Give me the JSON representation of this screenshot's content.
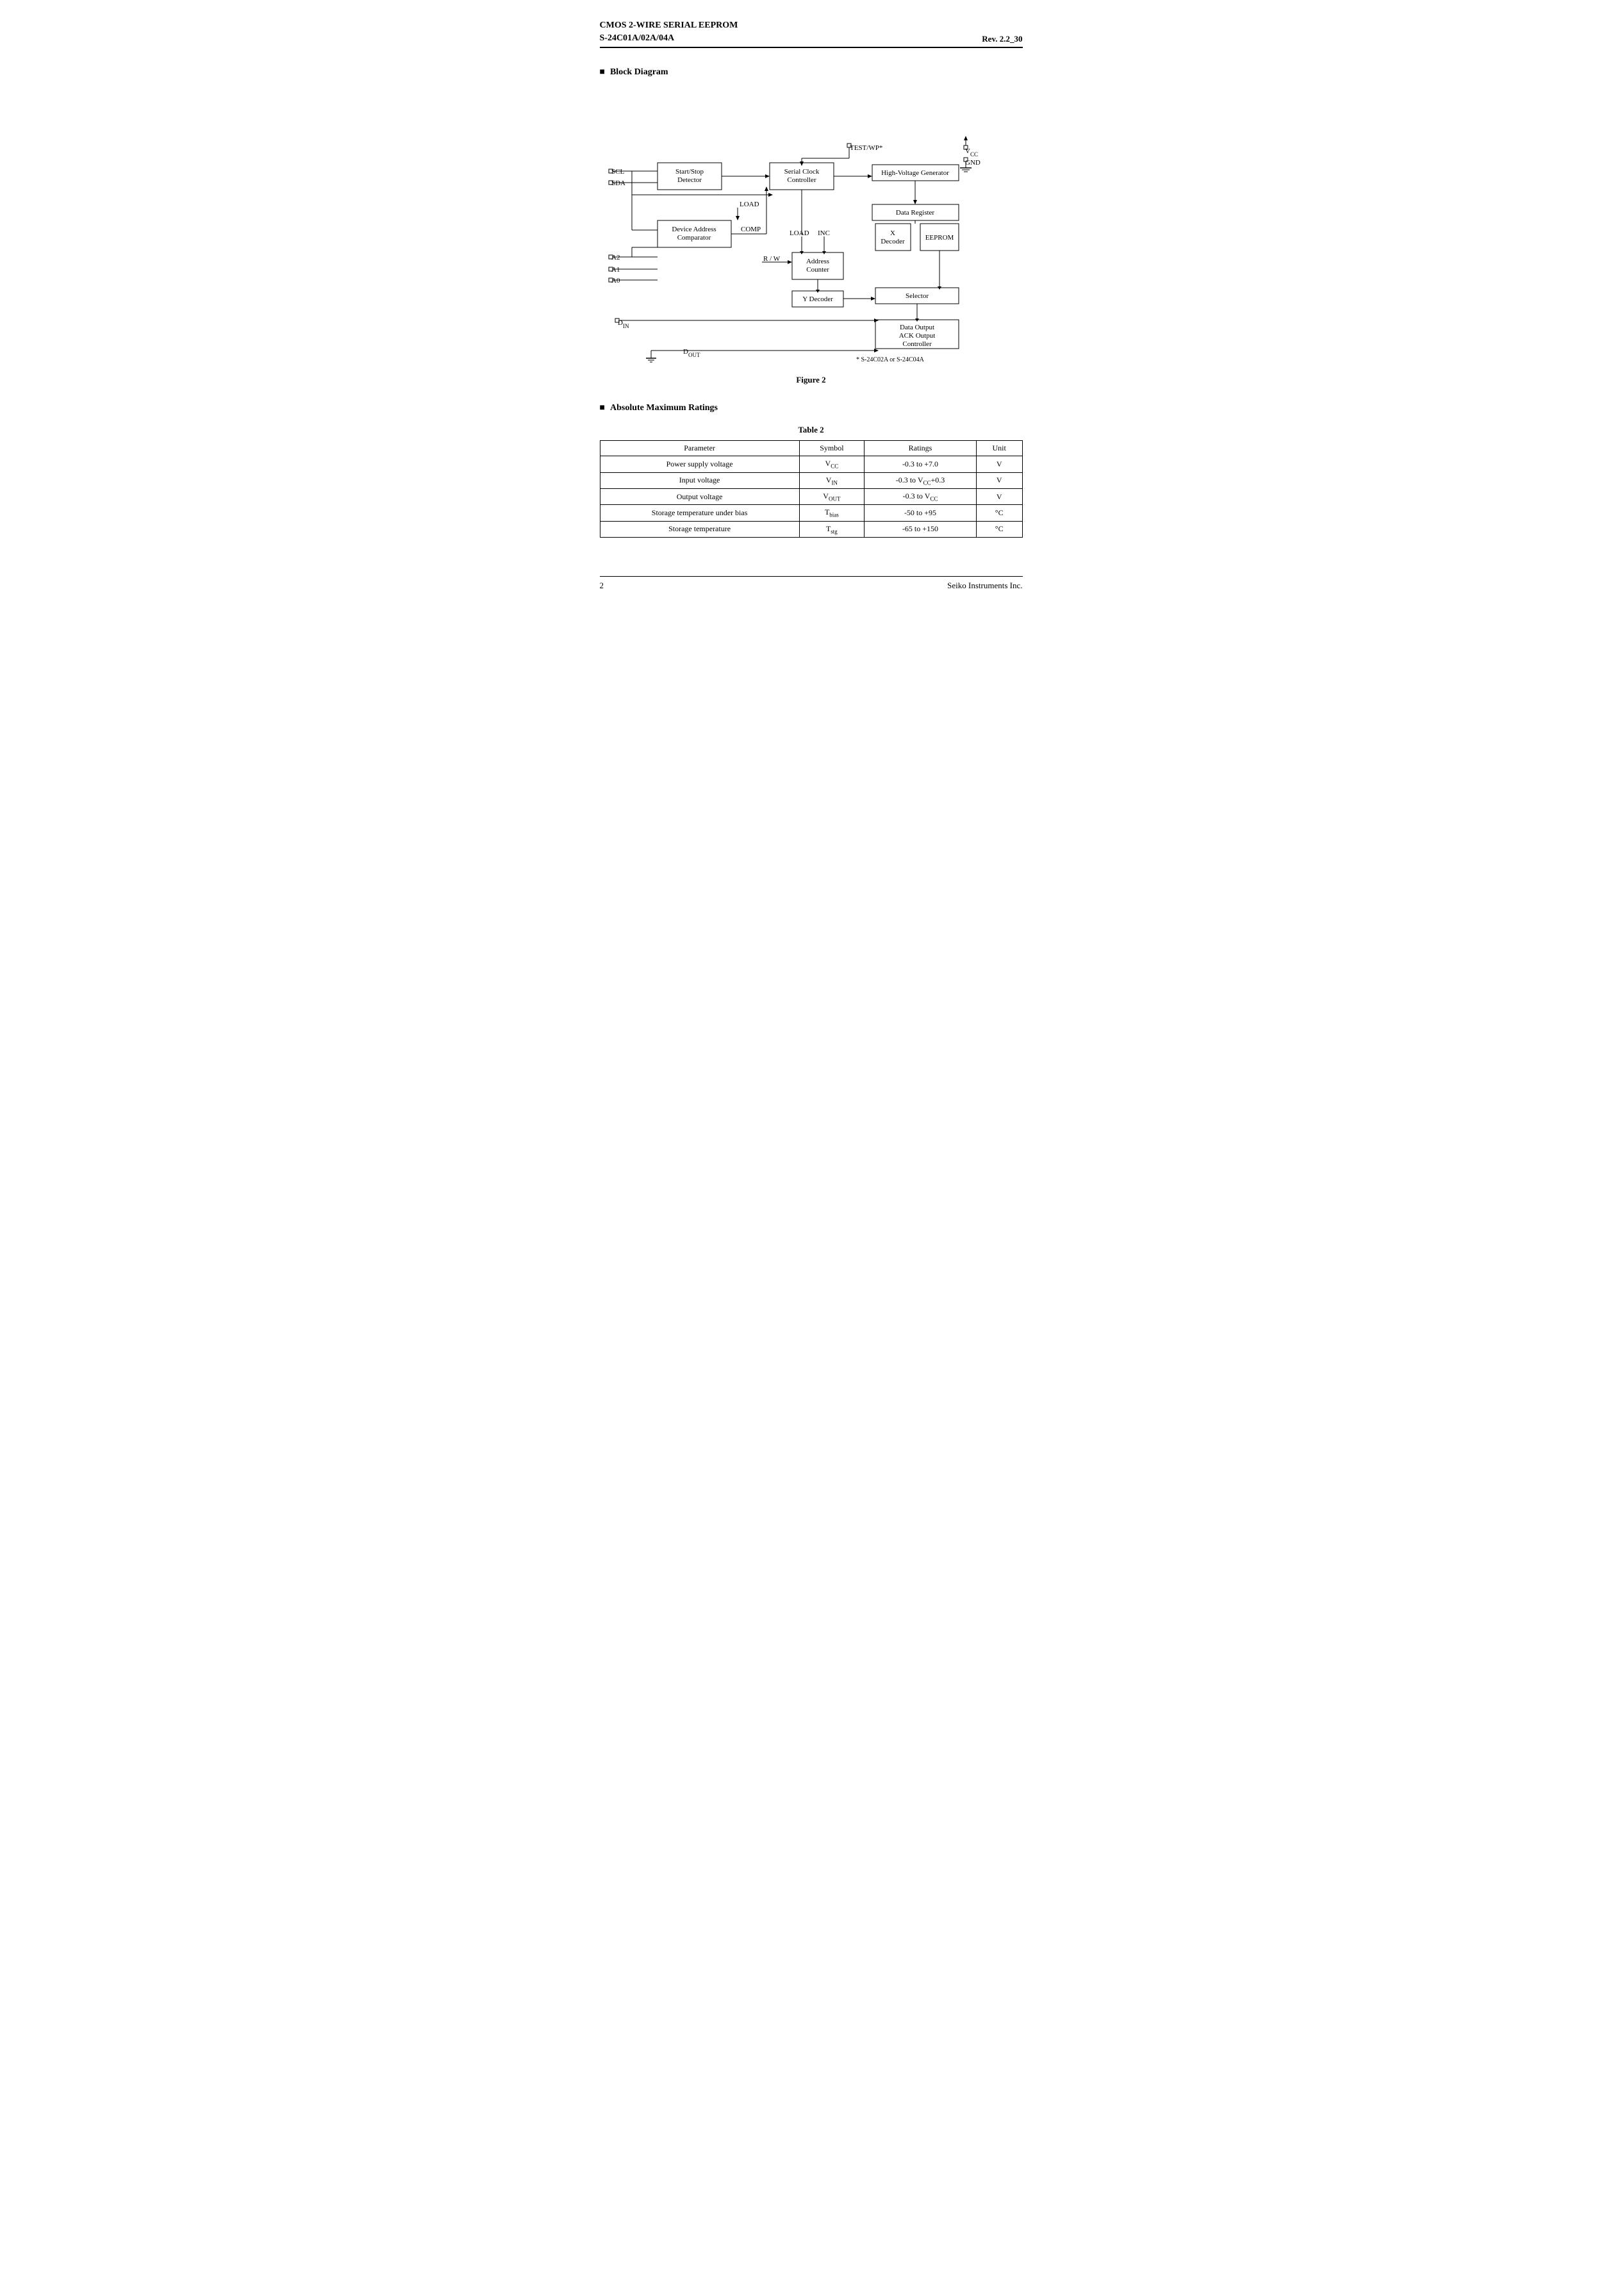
{
  "header": {
    "title_line1": "CMOS 2-WIRE SERIAL  EEPROM",
    "title_line2": "S-24C01A/02A/04A",
    "revision": "Rev. 2.2",
    "page_suffix": "_30"
  },
  "block_diagram": {
    "heading": "Block Diagram",
    "figure_label": "Figure 2",
    "footnote": "*   S-24C02A or S-24C04A",
    "blocks": {
      "start_stop": "Start/Stop\nDetector",
      "serial_clock": "Serial Clock\nController",
      "high_voltage": "High-Voltage Generator",
      "device_address": "Device Address\nComparator",
      "address_counter": "Address\nCounter",
      "y_decoder": "Y Decoder",
      "x_decoder": "X\nDecoder",
      "data_register": "Data Register",
      "eeprom": "EEPROM",
      "selector": "Selector",
      "data_output": "Data Output\nACK Output\nController"
    },
    "labels": {
      "scl": "SCL",
      "sda": "SDA",
      "a2": "A2",
      "a1": "A1",
      "a0": "A0",
      "din": "D",
      "din_sub": "IN",
      "dout": "D",
      "dout_sub": "OUT",
      "load": "LOAD",
      "comp": "COMP",
      "load2": "LOAD",
      "inc": "INC",
      "rw": "R / W",
      "test_wp": "TEST/WP*",
      "vcc": "V",
      "vcc_sub": "CC",
      "gnd": "GND"
    }
  },
  "table": {
    "heading": "Absolute Maximum Ratings",
    "caption": "Table  2",
    "columns": [
      "Parameter",
      "Symbol",
      "Ratings",
      "Unit"
    ],
    "rows": [
      [
        "Power supply voltage",
        "V_CC",
        "-0.3 to +7.0",
        "V"
      ],
      [
        "Input voltage",
        "V_IN",
        "-0.3 to V_CC+0.3",
        "V"
      ],
      [
        "Output voltage",
        "V_OUT",
        "-0.3 to V_CC",
        "V"
      ],
      [
        "Storage temperature under bias",
        "T_bias",
        "-50 to +95",
        "°C"
      ],
      [
        "Storage temperature",
        "T_stg",
        "-65 to +150",
        "°C"
      ]
    ]
  },
  "footer": {
    "page_number": "2",
    "company": "Seiko Instruments Inc."
  }
}
